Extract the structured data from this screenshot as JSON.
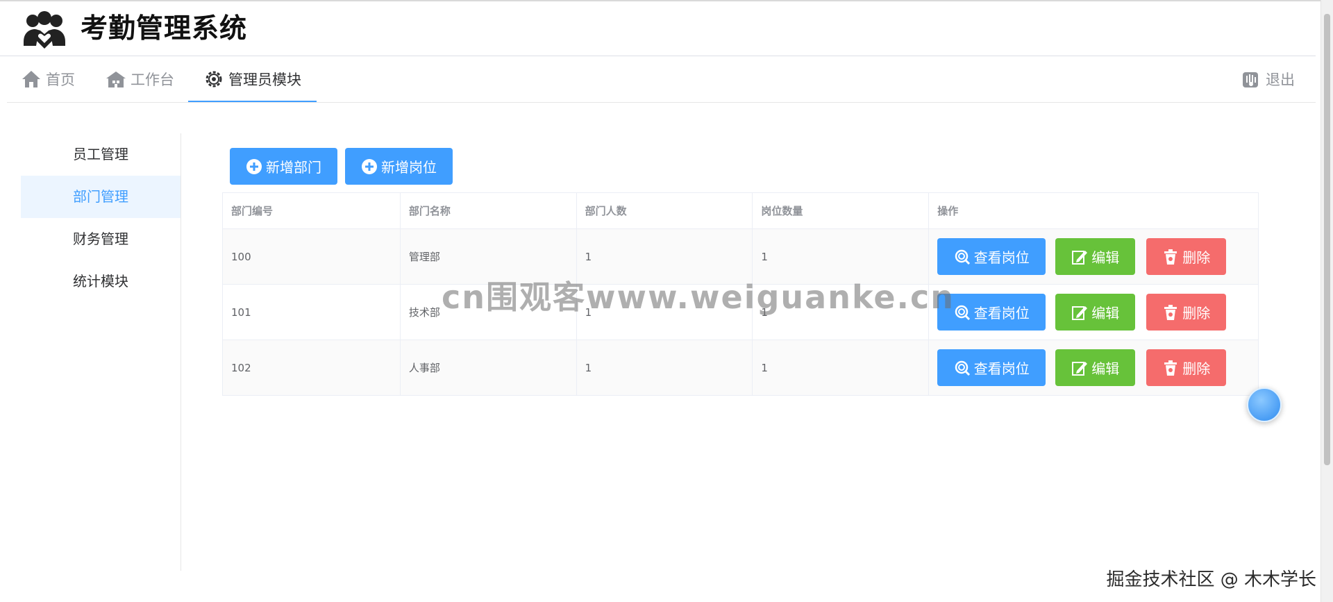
{
  "app": {
    "title": "考勤管理系统"
  },
  "topnav": {
    "home": "首页",
    "workbench": "工作台",
    "admin": "管理员模块",
    "logout": "退出"
  },
  "sidebar": {
    "items": [
      {
        "label": "员工管理",
        "active": false
      },
      {
        "label": "部门管理",
        "active": true
      },
      {
        "label": "财务管理",
        "active": false
      },
      {
        "label": "统计模块",
        "active": false
      }
    ]
  },
  "toolbar": {
    "add_dept": "新增部门",
    "add_post": "新增岗位"
  },
  "table": {
    "headers": [
      "部门编号",
      "部门名称",
      "部门人数",
      "岗位数量",
      "操作"
    ],
    "rows": [
      {
        "id": "100",
        "name": "管理部",
        "people": "1",
        "posts": "1"
      },
      {
        "id": "101",
        "name": "技术部",
        "people": "1",
        "posts": "1"
      },
      {
        "id": "102",
        "name": "人事部",
        "people": "1",
        "posts": "1"
      }
    ],
    "actions": {
      "view": "查看岗位",
      "edit": "编辑",
      "delete": "删除"
    }
  },
  "watermarks": {
    "center": "cn围观客www.weiguanke.cn",
    "corner": "掘金技术社区 @ 木木学长"
  },
  "colors": {
    "primary": "#409eff",
    "success": "#67c23a",
    "danger": "#f56c6c",
    "active_bg": "#ecf5ff"
  },
  "icons": {
    "logo": "users-heart-icon",
    "home": "home-icon",
    "workbench": "house-icon",
    "admin": "gear-icon",
    "logout": "hand-icon",
    "add": "circle-plus-icon",
    "view": "search-icon",
    "edit": "edit-icon",
    "delete": "trash-icon"
  }
}
